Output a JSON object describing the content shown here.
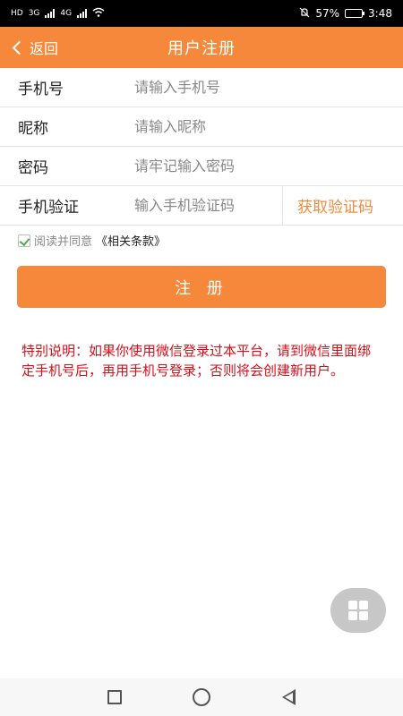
{
  "status_bar": {
    "hd": "HD",
    "net1": "3G",
    "net2": "4G",
    "battery": "57%",
    "time": "3:48",
    "battery_level": 57
  },
  "header": {
    "back_label": "返回",
    "title": "用户注册",
    "color": "#f5883a"
  },
  "form": {
    "phone": {
      "label": "手机号",
      "placeholder": "请输入手机号"
    },
    "nickname": {
      "label": "昵称",
      "placeholder": "请输入昵称"
    },
    "password": {
      "label": "密码",
      "placeholder": "请牢记输入密码"
    },
    "verify": {
      "label": "手机验证",
      "placeholder": "输入手机验证码",
      "get_code_label": "获取验证码"
    }
  },
  "agreement": {
    "checked": true,
    "text": "阅读并同意",
    "link": "《相关条款》"
  },
  "register_button": {
    "label": "注 册"
  },
  "notice": "特别说明：如果你使用微信登录过本平台，请到微信里面绑定手机号后，再用手机号登录；否则将会创建新用户。",
  "icons": {
    "back": "chevron-left-icon",
    "float": "grid-icon",
    "nav": [
      "square-icon",
      "circle-icon",
      "triangle-back-icon"
    ]
  }
}
